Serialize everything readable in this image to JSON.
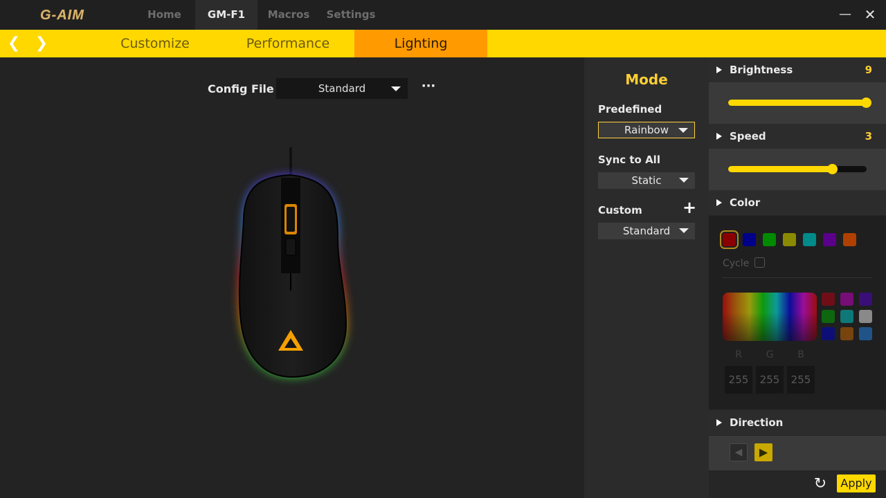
{
  "app": {
    "logo_text": "G-AIM"
  },
  "top_tabs": [
    {
      "label": "Home",
      "active": false
    },
    {
      "label": "GM-F1",
      "active": true
    },
    {
      "label": "Macros",
      "active": false
    },
    {
      "label": "Settings",
      "active": false
    }
  ],
  "window_controls": {
    "minimize": "—",
    "close": "✕"
  },
  "sub_nav": {
    "prev_icon": "❮",
    "next_icon": "❯",
    "tabs": [
      {
        "label": "Customize",
        "active": false
      },
      {
        "label": "Performance",
        "active": false
      },
      {
        "label": "Lighting",
        "active": true
      }
    ]
  },
  "config": {
    "label": "Config File",
    "value": "Standard",
    "more": "···"
  },
  "mode": {
    "title": "Mode",
    "predefined": {
      "label": "Predefined",
      "value": "Rainbow"
    },
    "sync": {
      "label": "Sync to All",
      "value": "Static"
    },
    "custom": {
      "label": "Custom",
      "value": "Standard",
      "add_icon": "+"
    }
  },
  "brightness": {
    "label": "Brightness",
    "value": "9",
    "fraction": 1.0
  },
  "speed": {
    "label": "Speed",
    "value": "3",
    "fraction": 0.75
  },
  "color": {
    "label": "Color",
    "swatches": [
      "#8a0000",
      "#00008a",
      "#008a00",
      "#8a8a00",
      "#008a8a",
      "#5a008a",
      "#b04000"
    ],
    "cycle_label": "Cycle",
    "palette": [
      "#b00010",
      "#c000c0",
      "#5000c0",
      "#00a000",
      "#00c0c0",
      "#e0e0e0",
      "#0000c0",
      "#c06000",
      "#2080e0"
    ],
    "rgb_labels": [
      "R",
      "G",
      "B"
    ],
    "rgb_values": [
      "255",
      "255",
      "255"
    ]
  },
  "direction": {
    "label": "Direction",
    "left_icon": "◀",
    "right_icon": "▶"
  },
  "footer": {
    "refresh_icon": "↻",
    "apply_label": "Apply"
  },
  "colors": {
    "accent": "#ffd800",
    "active_tab": "#ff9a00",
    "mode_title": "#ffcf33"
  }
}
